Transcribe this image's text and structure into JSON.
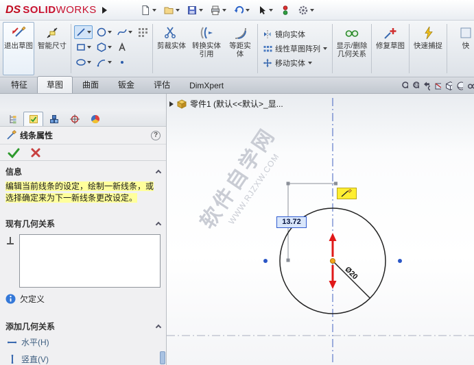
{
  "colors": {
    "brand_red": "#c8102e",
    "selection_blue": "#2f5bd0",
    "highlight_yellow": "#ffff9c"
  },
  "titlebar": {
    "logo_ds": "DS",
    "logo_solid": "SOLID",
    "logo_works": "WORKS"
  },
  "ribbon": {
    "exit_sketch": "退出草图",
    "smart_dimension": "智能尺寸",
    "trim": "剪裁实体",
    "convert": "转换实体引用",
    "offset": "等距实体",
    "mirror": "镜向实体",
    "linear_pattern": "线性草图阵列",
    "move": "移动实体",
    "display_relations": "显示/删除几何关系",
    "repair": "修复草图",
    "quick_snap": "快速捕捉",
    "overflow": "快"
  },
  "tabs": {
    "items": [
      {
        "label": "特征"
      },
      {
        "label": "草图"
      },
      {
        "label": "曲面"
      },
      {
        "label": "钣金"
      },
      {
        "label": "评估"
      },
      {
        "label": "DimXpert"
      }
    ]
  },
  "panel": {
    "title": "线条属性",
    "help": "?",
    "info_title": "信息",
    "info_line1": "编辑当前线条的设定，绘制一新线条，或",
    "info_line2": "选择确定来为下一新线条更改设定。",
    "existing_title": "现有几何关系",
    "status": "欠定义",
    "add_title": "添加几何关系",
    "add_horizontal": "水平(H)",
    "add_vertical": "竖直(V)"
  },
  "canvas": {
    "breadcrumb": "零件1 (默认<<默认>_显...",
    "dimension": "13.72",
    "diameter": "Ø20",
    "watermark_cn": "软件自学网",
    "watermark_url": "WWW.RJZXW.COM"
  }
}
